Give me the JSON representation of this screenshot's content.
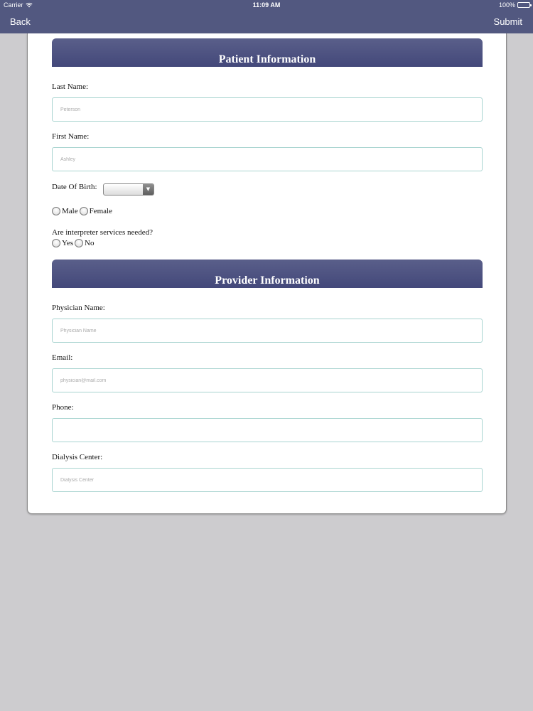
{
  "status_bar": {
    "carrier": "Carrier",
    "time": "11:09 AM",
    "battery": "100%"
  },
  "nav": {
    "back_label": "Back",
    "submit_label": "Submit"
  },
  "patient_section": {
    "title": "Patient Information",
    "last_name": {
      "label": "Last Name:",
      "placeholder": "Peterson"
    },
    "first_name": {
      "label": "First Name:",
      "placeholder": "Ashley"
    },
    "dob": {
      "label": "Date Of Birth:",
      "value": ""
    },
    "gender": {
      "options": [
        "Male",
        "Female"
      ]
    },
    "interpreter": {
      "question": "Are interpreter services needed?",
      "options": [
        "Yes",
        "No"
      ]
    }
  },
  "provider_section": {
    "title": "Provider Information",
    "physician_name": {
      "label": "Physician Name:",
      "placeholder": "Physician Name"
    },
    "email": {
      "label": "Email:",
      "placeholder": "physician@mail.com"
    },
    "phone": {
      "label": "Phone:",
      "placeholder": ""
    },
    "dialysis_center": {
      "label": "Dialysis Center:",
      "placeholder": "Dialysis Center"
    }
  }
}
